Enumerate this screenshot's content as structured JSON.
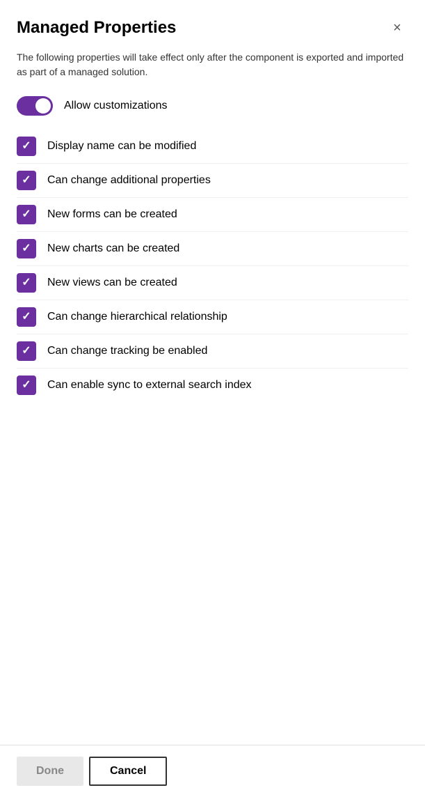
{
  "dialog": {
    "title": "Managed Properties",
    "description": "The following properties will take effect only after the component is exported and imported as part of a managed solution.",
    "close_label": "×"
  },
  "toggle": {
    "label": "Allow customizations",
    "checked": true
  },
  "checkboxes": [
    {
      "label": "Display name can be modified",
      "checked": true
    },
    {
      "label": "Can change additional properties",
      "checked": true
    },
    {
      "label": "New forms can be created",
      "checked": true
    },
    {
      "label": "New charts can be created",
      "checked": true
    },
    {
      "label": "New views can be created",
      "checked": true
    },
    {
      "label": "Can change hierarchical relationship",
      "checked": true
    },
    {
      "label": "Can change tracking be enabled",
      "checked": true
    },
    {
      "label": "Can enable sync to external search index",
      "checked": true
    }
  ],
  "footer": {
    "done_label": "Done",
    "cancel_label": "Cancel"
  }
}
